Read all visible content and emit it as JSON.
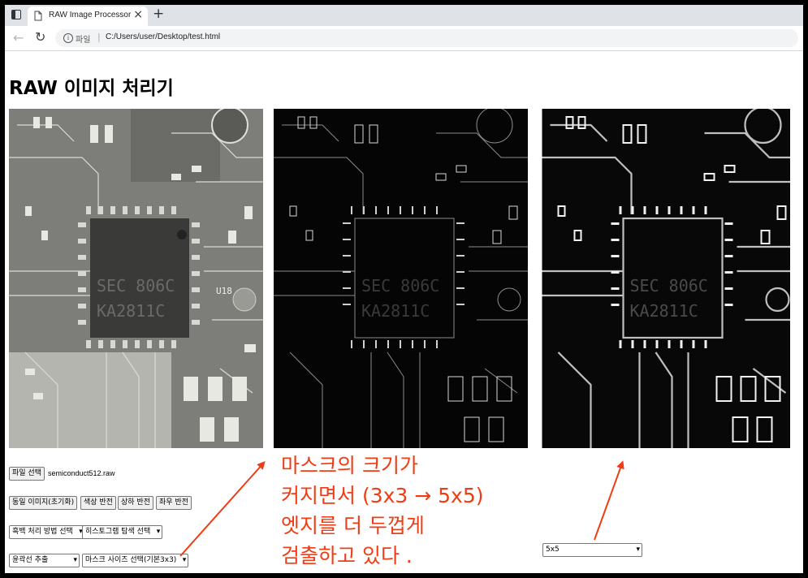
{
  "browser": {
    "tab_title": "RAW Image Processor",
    "new_tab": "+",
    "close": "×",
    "url_scheme": "파일",
    "url": "C:/Users/user/Desktop/test.html"
  },
  "page": {
    "title": "RAW 이미지 처리기",
    "chip_text": [
      "SEC 806C",
      "KA2811C"
    ],
    "chip_side_label": "U18",
    "file_button": "파일 선택",
    "file_name": "semiconduct512.raw",
    "buttons": [
      "동일 이미지(초기화)",
      "색상 반전",
      "상하 반전",
      "좌우 반전"
    ],
    "select_bw": "흑백 처리 방법 선택",
    "select_hist": "히스토그램 탐색 선택",
    "select_edge": "윤곽선 추출",
    "select_mask": "마스크 사이즈 선택(기본3x3)",
    "select_mask_right": "5x5"
  },
  "annotation": {
    "lines": [
      "마스크의 크기가",
      "커지면서 (3x3 → 5x5)",
      "엣지를 더 두껍게",
      "검출하고 있다 ."
    ],
    "color": "#f03c14"
  }
}
